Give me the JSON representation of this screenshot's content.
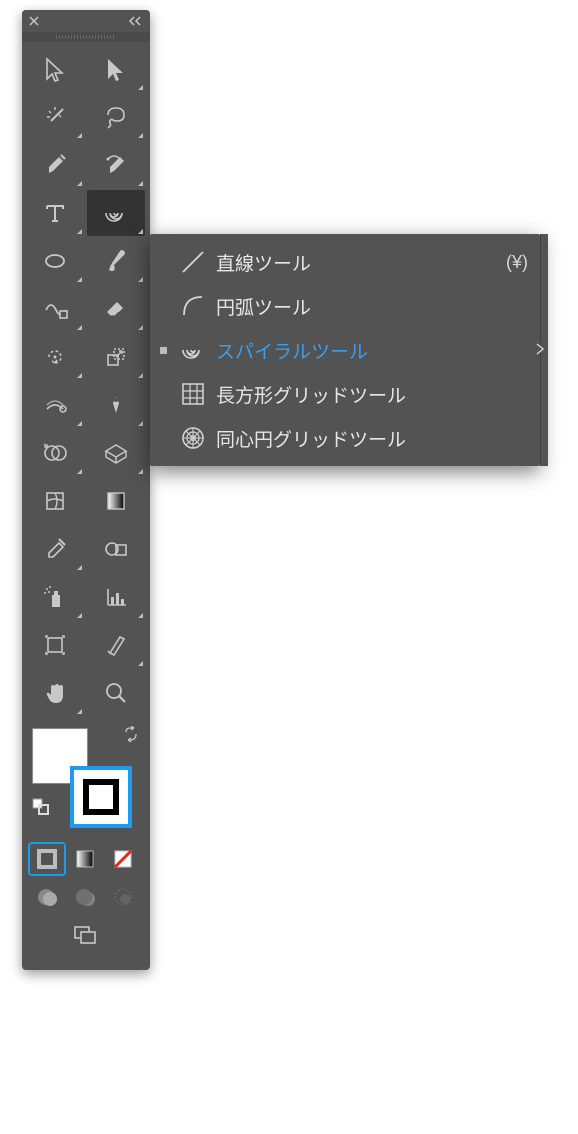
{
  "flyout": {
    "items": [
      {
        "label": "直線ツール",
        "shortcut": "(¥)",
        "icon": "line-icon",
        "selected": false
      },
      {
        "label": "円弧ツール",
        "shortcut": "",
        "icon": "arc-icon",
        "selected": false
      },
      {
        "label": "スパイラルツール",
        "shortcut": "",
        "icon": "spiral-icon",
        "selected": true
      },
      {
        "label": "長方形グリッドツール",
        "shortcut": "",
        "icon": "rect-grid-icon",
        "selected": false
      },
      {
        "label": "同心円グリッドツール",
        "shortcut": "",
        "icon": "polar-grid-icon",
        "selected": false
      }
    ]
  },
  "tools": [
    {
      "name": "selection-tool",
      "icon": "selection",
      "flyout": false
    },
    {
      "name": "direct-selection-tool",
      "icon": "direct-selection",
      "flyout": true
    },
    {
      "name": "magic-wand-tool",
      "icon": "magic-wand",
      "flyout": true
    },
    {
      "name": "lasso-tool",
      "icon": "lasso",
      "flyout": true
    },
    {
      "name": "pen-tool",
      "icon": "pen",
      "flyout": true
    },
    {
      "name": "curvature-pen-tool",
      "icon": "curvature",
      "flyout": true
    },
    {
      "name": "type-tool",
      "icon": "type",
      "flyout": true
    },
    {
      "name": "line-segment-tool",
      "icon": "spiral",
      "flyout": true,
      "active": true
    },
    {
      "name": "ellipse-tool",
      "icon": "ellipse",
      "flyout": true
    },
    {
      "name": "paintbrush-tool",
      "icon": "brush",
      "flyout": true
    },
    {
      "name": "shaper-tool",
      "icon": "shaper",
      "flyout": true
    },
    {
      "name": "eraser-tool",
      "icon": "eraser",
      "flyout": true
    },
    {
      "name": "rotate-tool",
      "icon": "rotate",
      "flyout": true
    },
    {
      "name": "scale-tool",
      "icon": "scale",
      "flyout": true
    },
    {
      "name": "width-tool",
      "icon": "width",
      "flyout": true
    },
    {
      "name": "free-transform-tool",
      "icon": "pin",
      "flyout": true
    },
    {
      "name": "shape-builder-tool",
      "icon": "shape-builder",
      "flyout": true
    },
    {
      "name": "perspective-grid-tool",
      "icon": "perspective",
      "flyout": true
    },
    {
      "name": "mesh-tool",
      "icon": "mesh",
      "flyout": false
    },
    {
      "name": "gradient-tool",
      "icon": "gradient",
      "flyout": false
    },
    {
      "name": "eyedropper-tool",
      "icon": "eyedropper",
      "flyout": true
    },
    {
      "name": "blend-tool",
      "icon": "blend",
      "flyout": false
    },
    {
      "name": "symbol-sprayer-tool",
      "icon": "spray",
      "flyout": true
    },
    {
      "name": "column-graph-tool",
      "icon": "graph",
      "flyout": true
    },
    {
      "name": "artboard-tool",
      "icon": "artboard",
      "flyout": false
    },
    {
      "name": "slice-tool",
      "icon": "slice",
      "flyout": true
    },
    {
      "name": "hand-tool",
      "icon": "hand",
      "flyout": true
    },
    {
      "name": "zoom-tool",
      "icon": "zoom",
      "flyout": false
    }
  ],
  "colors": {
    "fill": "#ffffff",
    "stroke": "#000000",
    "stroke_focused": true
  },
  "color_modes": [
    "color",
    "gradient",
    "none"
  ],
  "selected_color_mode": 0,
  "draw_modes": [
    "normal",
    "behind",
    "inside"
  ]
}
